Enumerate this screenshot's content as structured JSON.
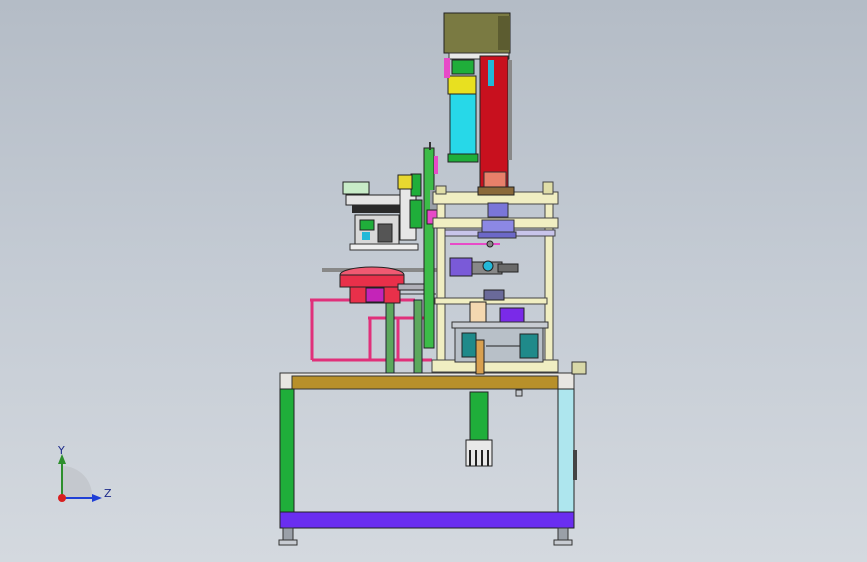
{
  "viewport": {
    "background": [
      "#b4bcc6",
      "#d4d9df"
    ],
    "view_mode": "shaded-with-edges",
    "model": "assembly-machine"
  },
  "triad": {
    "axis_y_label": "Y",
    "axis_z_label": "Z",
    "y_color": "#2d8f2d",
    "z_color": "#1f3fd6",
    "x_color": "#d81f1f",
    "icon": "coordinate-triad-icon"
  },
  "colors": {
    "table_green": "#1fae3a",
    "table_cyan": "#aee6ee",
    "base_purple": "#6a2ef0",
    "top_band_gold": "#b8902a",
    "plate_cream": "#f0eec2",
    "column_red": "#c8101e",
    "motor_olive": "#7a7a42",
    "cylinder_cyan": "#27d8e8",
    "bowl_red": "#e8304a",
    "frame_pink": "#e0307a"
  }
}
